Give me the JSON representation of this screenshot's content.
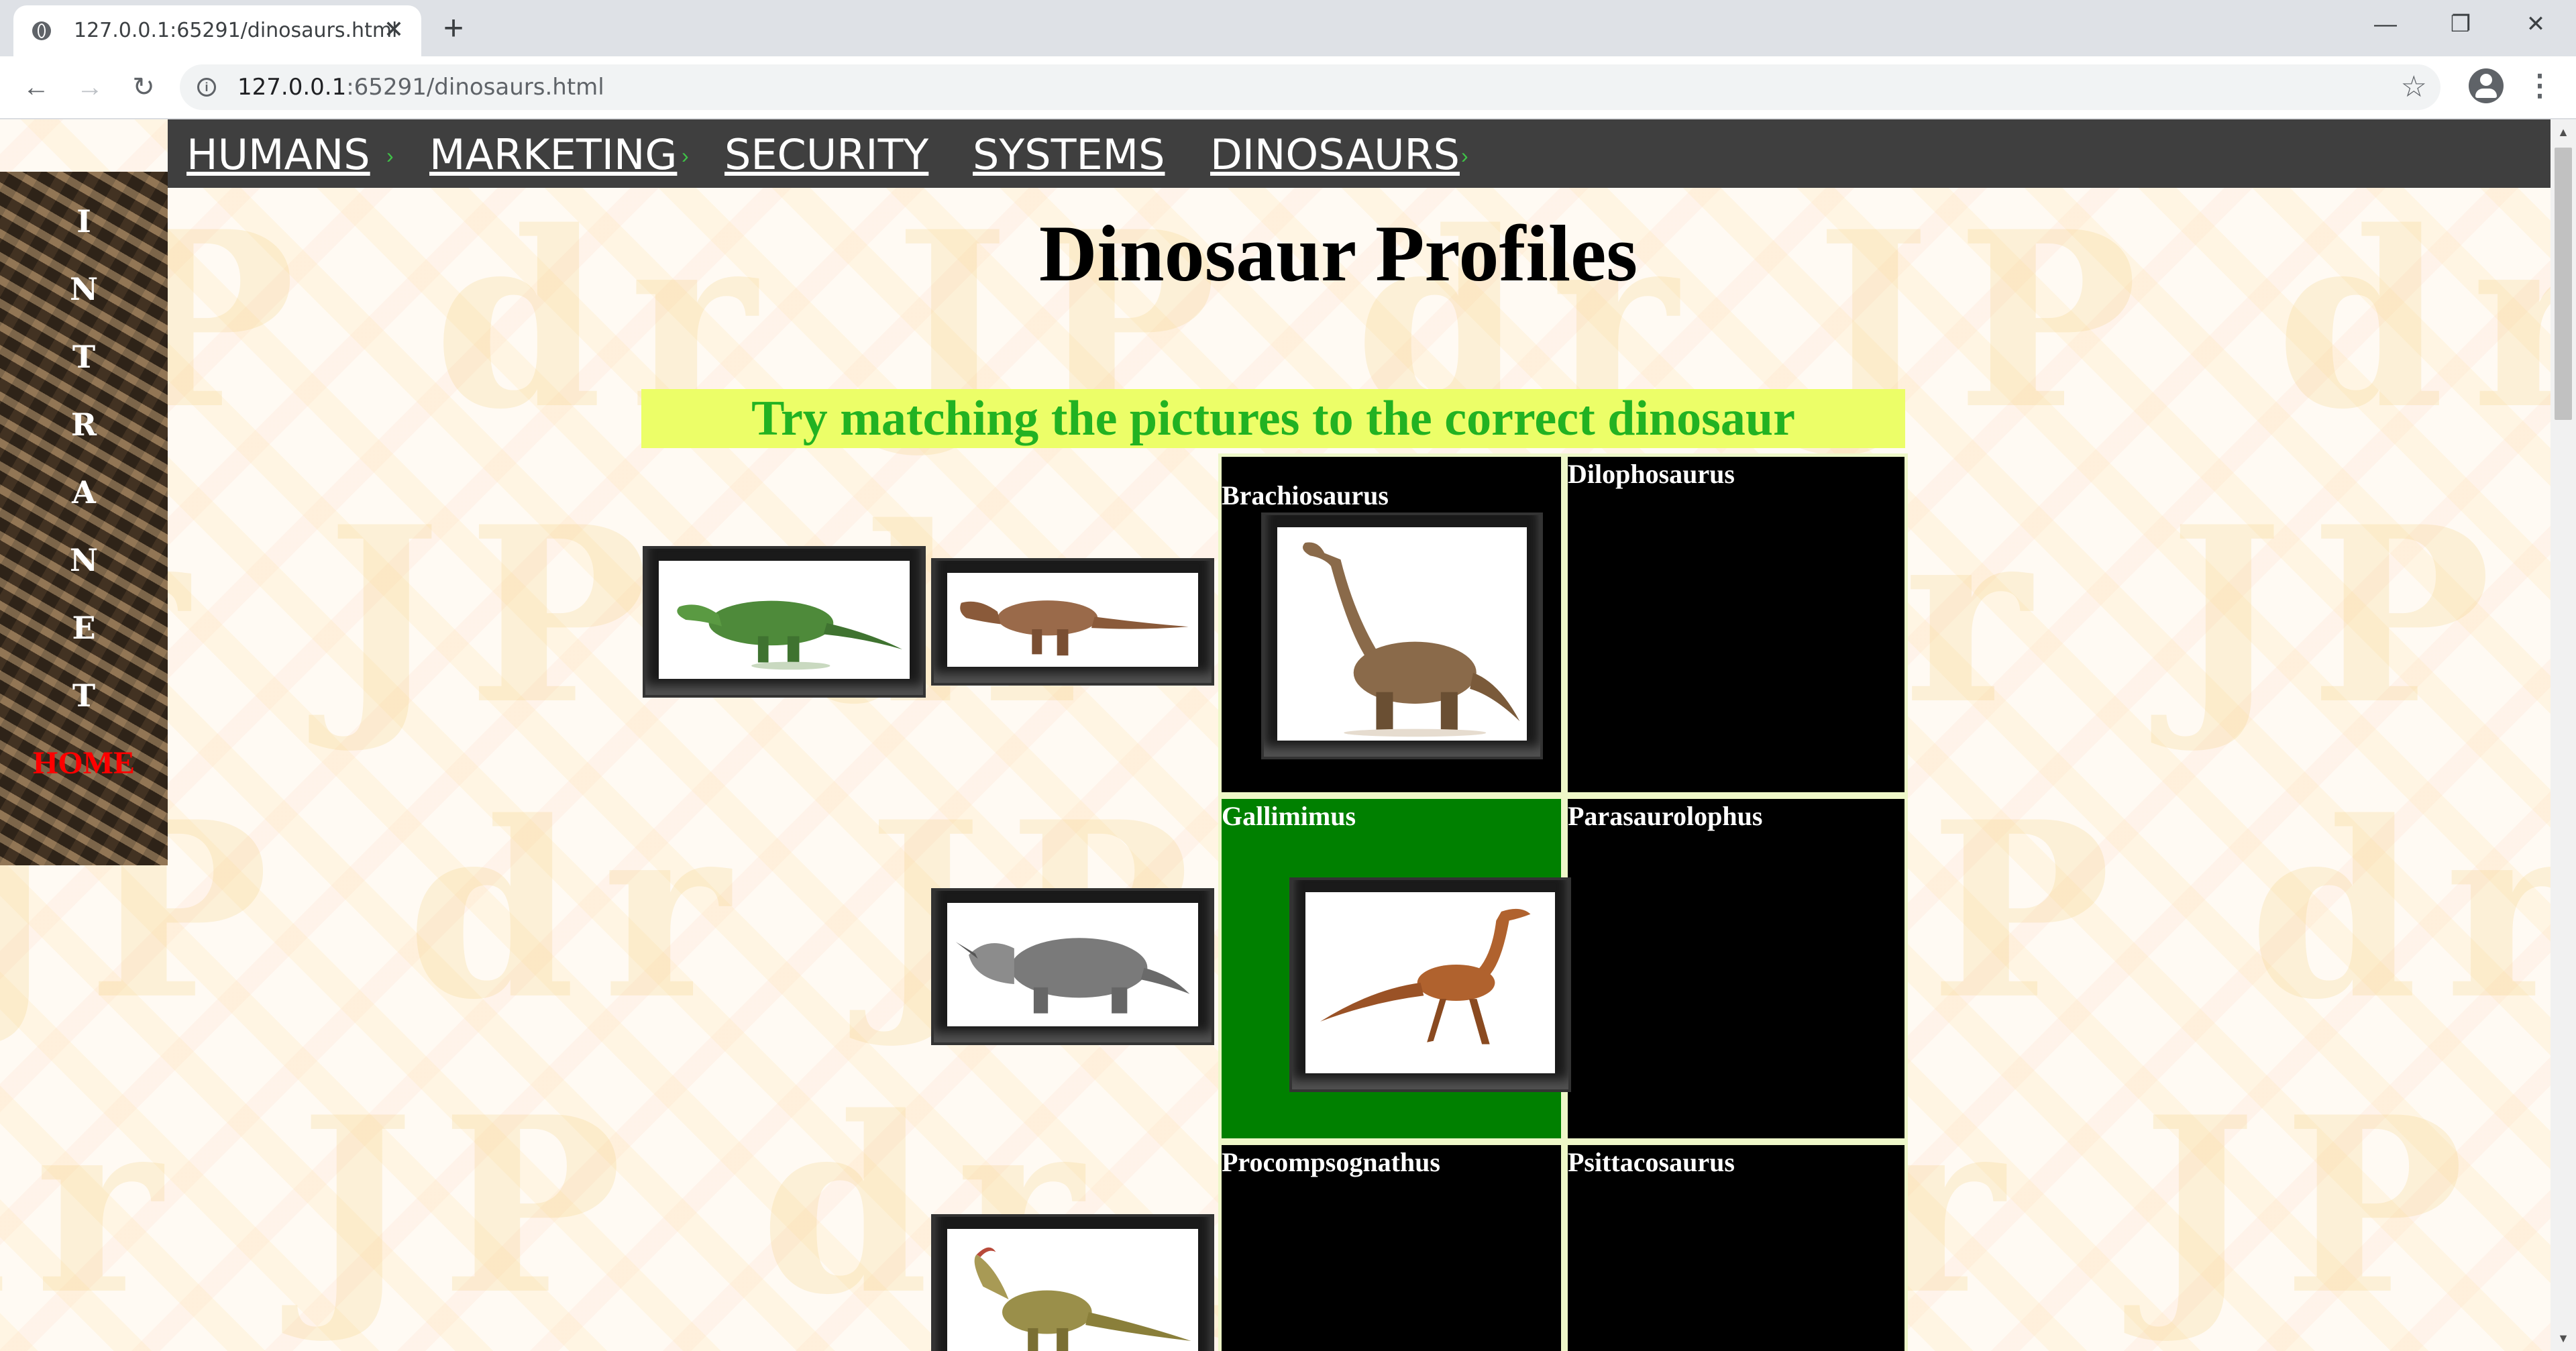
{
  "browser": {
    "tab_title": "127.0.0.1:65291/dinosaurs.html",
    "url_host": "127.0.0.1",
    "url_path": ":65291/dinosaurs.html",
    "new_tab": "+",
    "close": "✕",
    "minimize": "—",
    "restore": "❐",
    "window_close": "✕"
  },
  "nav": {
    "items": [
      {
        "label": "HUMANS",
        "has_arrow": true
      },
      {
        "label": "MARKETING",
        "has_arrow": true
      },
      {
        "label": "SECURITY",
        "has_arrow": false
      },
      {
        "label": "SYSTEMS",
        "has_arrow": false
      },
      {
        "label": "DINOSAURS",
        "has_arrow": true
      }
    ],
    "arrow_glyph": "›"
  },
  "sidebar": {
    "letters": [
      "I",
      "N",
      "T",
      "R",
      "A",
      "N",
      "E",
      "T"
    ],
    "home": "HOME"
  },
  "page": {
    "title": "Dinosaur Profiles",
    "instruction": "Try matching the pictures to the correct dinosaur"
  },
  "cells": [
    {
      "name": "Brachiosaurus",
      "state": "default"
    },
    {
      "name": "Dilophosaurus",
      "state": "default"
    },
    {
      "name": "Gallimimus",
      "state": "correct"
    },
    {
      "name": "Parasaurolophus",
      "state": "default"
    },
    {
      "name": "Procompsognathus",
      "state": "default"
    },
    {
      "name": "Psittacosaurus",
      "state": "default"
    }
  ],
  "pictures": [
    {
      "icon": "green-dinosaur-icon",
      "color": "#4e8a3a"
    },
    {
      "icon": "tyrannosaurus-icon",
      "color": "#9a6a4a"
    },
    {
      "icon": "triceratops-icon",
      "color": "#7a7a7a"
    },
    {
      "icon": "dilophosaurus-icon",
      "color": "#9a8f4a"
    },
    {
      "icon": "brachiosaurus-icon",
      "color": "#8a6a4a"
    },
    {
      "icon": "gallimimus-icon",
      "color": "#b0622e"
    }
  ],
  "colors": {
    "nav_bg": "#3f3f3f",
    "nav_arrow": "#3fc247",
    "instruction_bg": "#ecfe68",
    "instruction_text": "#22b222",
    "correct_cell": "#008000",
    "home_link": "#ff0000"
  }
}
